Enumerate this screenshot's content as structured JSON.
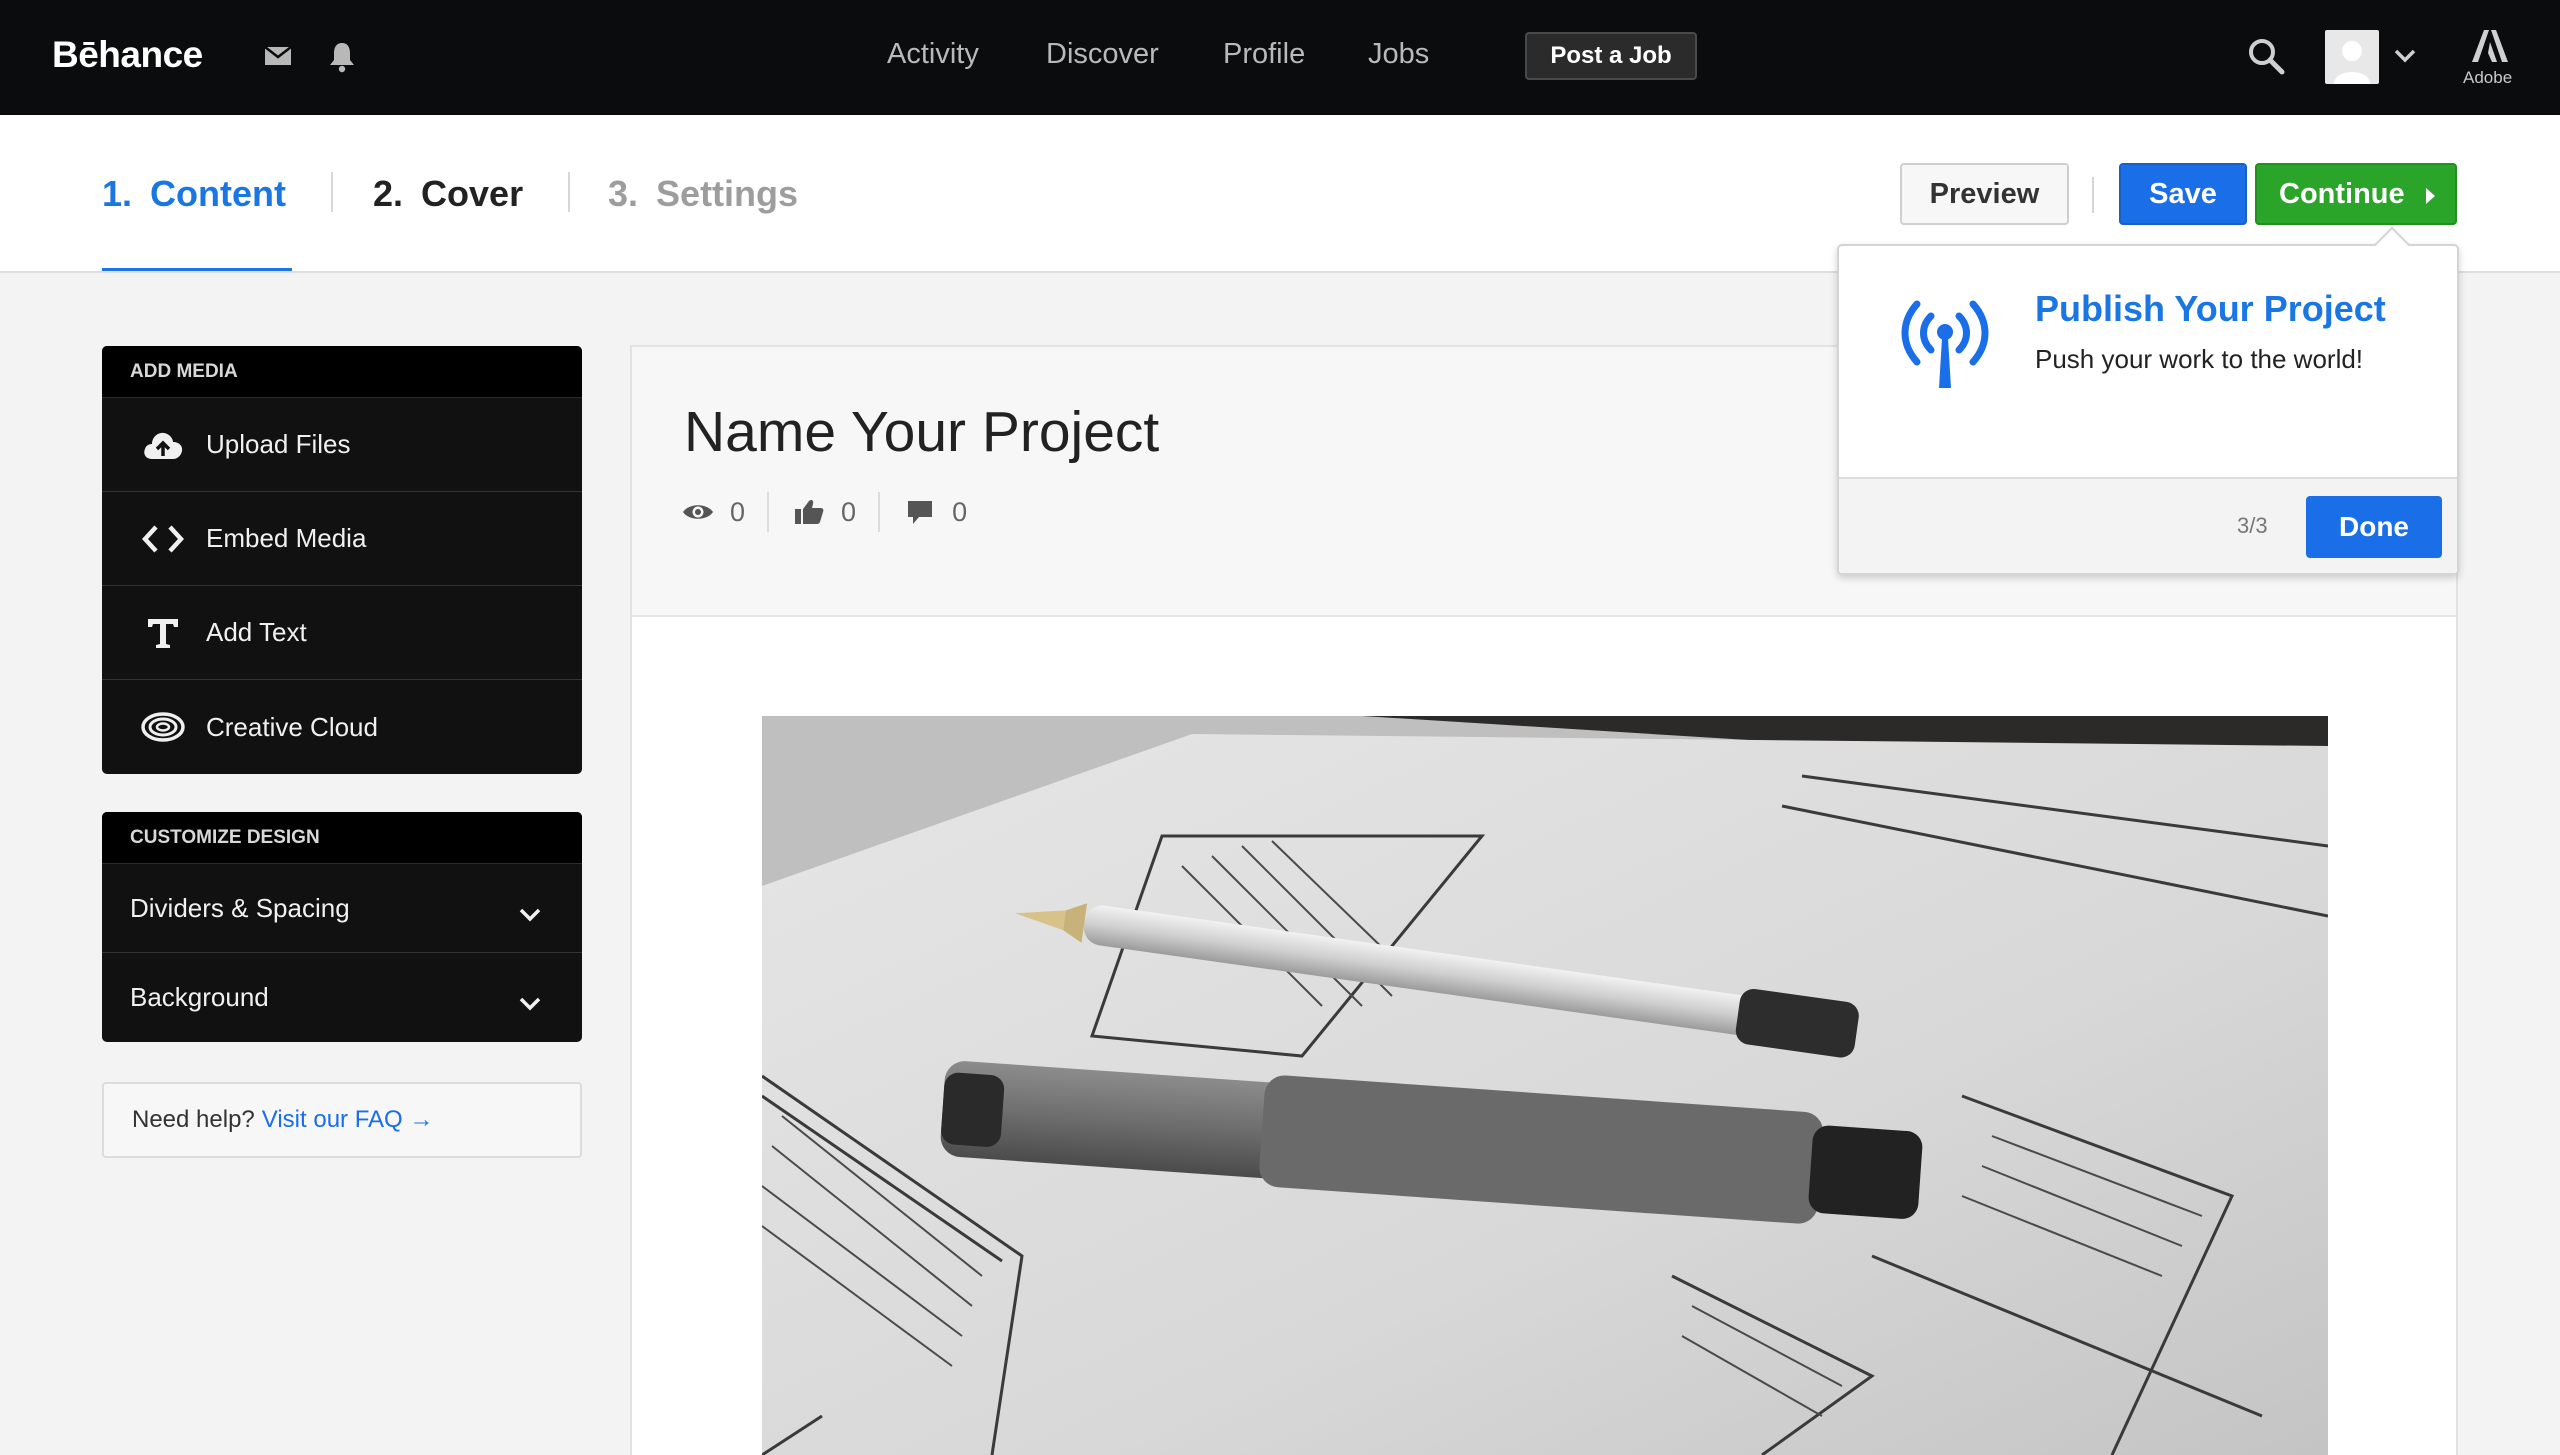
{
  "topbar": {
    "logo": "Bēhance",
    "nav": [
      "Activity",
      "Discover",
      "Profile",
      "Jobs"
    ],
    "post_job": "Post a Job",
    "adobe": "Adobe",
    "icons": [
      "mail-icon",
      "bell-icon",
      "search-icon",
      "avatar",
      "chevron-down-icon",
      "adobe-logo-icon"
    ]
  },
  "steps": [
    {
      "num": "1.",
      "label": "Content",
      "state": "active"
    },
    {
      "num": "2.",
      "label": "Cover",
      "state": "available"
    },
    {
      "num": "3.",
      "label": "Settings",
      "state": "disabled"
    }
  ],
  "actions": {
    "preview": "Preview",
    "save": "Save",
    "continue": "Continue"
  },
  "sidebar": {
    "add_media": {
      "title": "ADD MEDIA",
      "items": [
        {
          "label": "Upload Files",
          "icon": "cloud-upload-icon"
        },
        {
          "label": "Embed Media",
          "icon": "code-brackets-icon"
        },
        {
          "label": "Add Text",
          "icon": "text-t-icon"
        },
        {
          "label": "Creative Cloud",
          "icon": "creative-cloud-icon"
        }
      ]
    },
    "customize": {
      "title": "CUSTOMIZE DESIGN",
      "items": [
        {
          "label": "Dividers & Spacing"
        },
        {
          "label": "Background"
        }
      ]
    },
    "help": {
      "text": "Need help?",
      "link": "Visit our FAQ →"
    }
  },
  "project": {
    "title": "Name Your Project",
    "views": "0",
    "appreciations": "0",
    "comments": "0"
  },
  "popover": {
    "title": "Publish Your Project",
    "subtitle": "Push your work to the world!",
    "count": "3/3",
    "done": "Done",
    "icon": "broadcast-antenna-icon"
  },
  "colors": {
    "accent_blue": "#1a76e3",
    "continue_green": "#2aa52a",
    "topbar": "#0b0c0d",
    "sidebar": "#111111"
  }
}
